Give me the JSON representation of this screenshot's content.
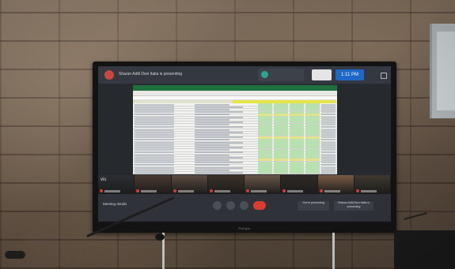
{
  "photo": {
    "subject": "wall-mounted display showing video meeting"
  },
  "meeting": {
    "presenter_banner": "Sharan Aditi Devi Italia is presenting",
    "clock": "1:11 PM",
    "meeting_details_label": "Meeting details",
    "you_are_presenting": "You're presenting",
    "other_presenting": "Sharan Aditi Devi Italia is presenting",
    "participants": [
      {
        "name": "vis"
      },
      {
        "name": ""
      },
      {
        "name": ""
      },
      {
        "name": ""
      },
      {
        "name": ""
      },
      {
        "name": ""
      },
      {
        "name": ""
      },
      {
        "name": ""
      }
    ]
  },
  "display_brand": "Philips",
  "colors": {
    "end_call": "#d93b30",
    "clock_bg": "#1d68c4",
    "sheet_header_highlight": "#e8e54a",
    "status_cells": "#b8e0b0"
  }
}
